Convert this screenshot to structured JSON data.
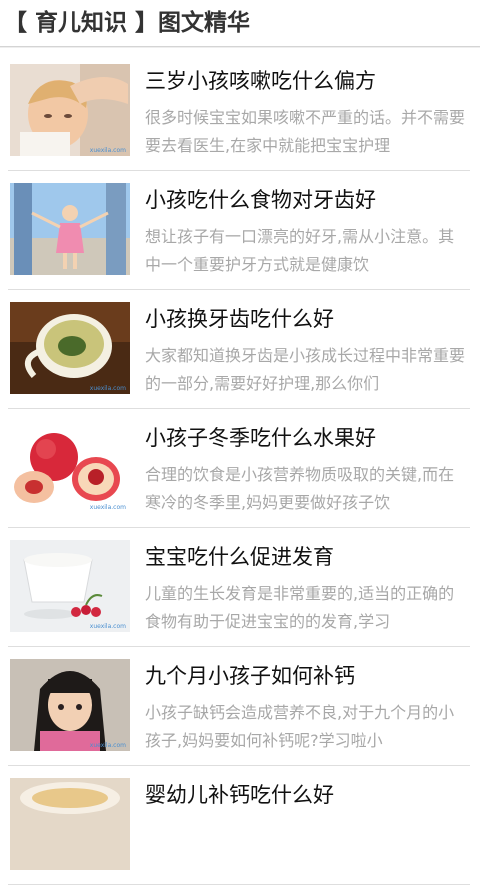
{
  "header": {
    "title": "【 育儿知识 】图文精华"
  },
  "articles": [
    {
      "title": "三岁小孩咳嗽吃什么偏方",
      "desc": "很多时候宝宝如果咳嗽不严重的话。并不需要要去看医生,在家中就能把宝宝护理",
      "thumb": "sick-child-image"
    },
    {
      "title": "小孩吃什么食物对牙齿好",
      "desc": "想让孩子有一口漂亮的好牙,需从小注意。其中一个重要护牙方式就是健康饮",
      "thumb": "child-walking-image"
    },
    {
      "title": "小孩换牙齿吃什么好",
      "desc": "大家都知道换牙齿是小孩成长过程中非常重要的一部分,需要好好护理,那么你们",
      "thumb": "tea-cup-image"
    },
    {
      "title": "小孩子冬季吃什么水果好",
      "desc": "合理的饮食是小孩营养物质吸取的关键,而在寒冷的冬季里,妈妈更要做好孩子饮",
      "thumb": "peach-image"
    },
    {
      "title": "宝宝吃什么促进发育",
      "desc": "儿童的生长发育是非常重要的,适当的正确的食物有助于促进宝宝的的发育,学习",
      "thumb": "yogurt-image"
    },
    {
      "title": "九个月小孩子如何补钙",
      "desc": "小孩子缺钙会造成营养不良,对于九个月的小孩子,妈妈要如何补钙呢?学习啦小",
      "thumb": "girl-portrait-image"
    },
    {
      "title": "婴幼儿补钙吃什么好",
      "desc": "",
      "thumb": "food-bowl-image"
    }
  ],
  "watermark": "xuexila.com"
}
